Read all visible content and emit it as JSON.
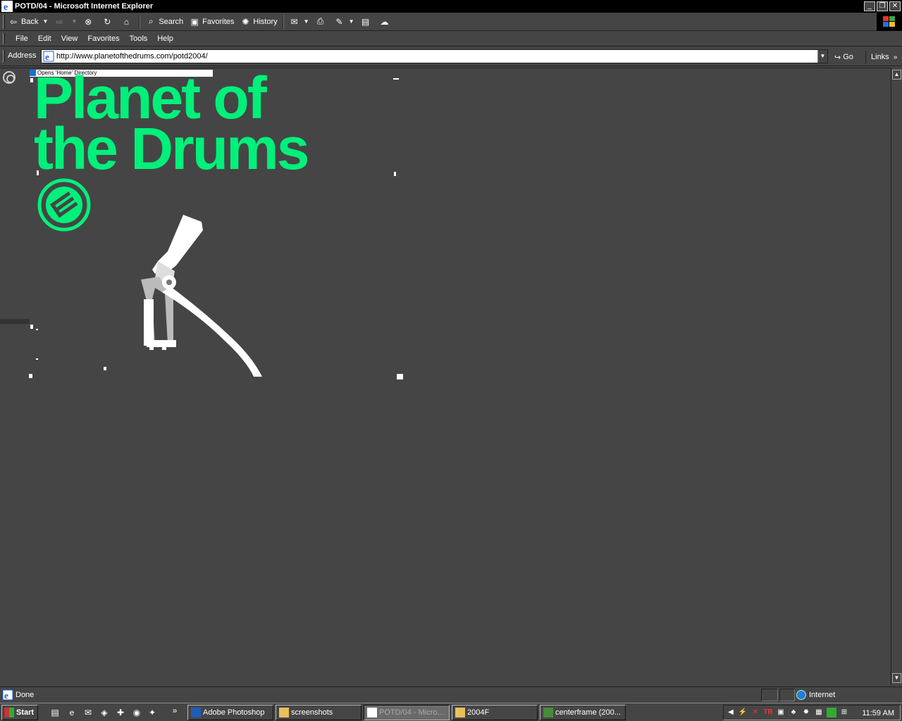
{
  "window": {
    "title": "POTD/04 - Microsoft Internet Explorer",
    "buttons": {
      "minimize": "_",
      "restore": "❐",
      "close": "✕"
    }
  },
  "toolbar": {
    "back": "Back",
    "search": "Search",
    "favorites": "Favorites",
    "history": "History"
  },
  "menu": [
    "File",
    "Edit",
    "View",
    "Favorites",
    "Tools",
    "Help"
  ],
  "address": {
    "label": "Address",
    "url": "http://www.planetofthedrums.com/potd2004/",
    "go": "Go",
    "links": "Links"
  },
  "page": {
    "tooltip": "Opens 'Home' Directory",
    "headline_line1": "Planet of",
    "headline_line2": "the Drums",
    "accent_color": "#00f07a",
    "background": "#454545"
  },
  "status": {
    "text": "Done",
    "zone": "Internet"
  },
  "taskbar": {
    "start": "Start",
    "more": "»",
    "tasks": [
      {
        "label": "Adobe Photoshop",
        "active": false
      },
      {
        "label": "screenshots",
        "active": false
      },
      {
        "label": "POTD/04 - Micro...",
        "active": true
      },
      {
        "label": "2004F",
        "active": false
      },
      {
        "label": "centerframe (200...",
        "active": false
      }
    ],
    "tray_tr": "TR",
    "clock": "11:59 AM"
  }
}
